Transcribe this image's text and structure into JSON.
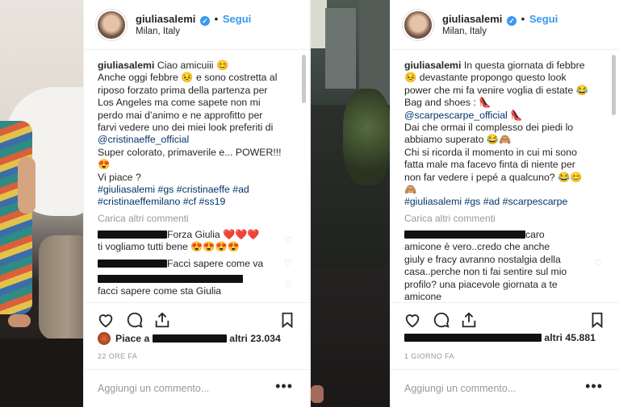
{
  "posts": [
    {
      "username": "giuliasalemi",
      "follow": "Segui",
      "location": "Milan, Italy",
      "caption": {
        "username": "giuliasalemi",
        "lines": [
          "Ciao amicuiii 😊",
          "Anche oggi febbre 😣 e sono costretta al",
          "riposo forzato prima della partenza per",
          "Los Angeles ma come sapete non mi",
          "perdo mai d’animo e ne approfitto per",
          "farvi vedere uno dei miei look preferiti di",
          "@cristinaeffe_official",
          "Super colorato, primaverile e... POWER!!!",
          "😍",
          "Vi piace ?",
          "#giuliasalemi #gs #cristinaeffe #ad",
          "#cristinaeffemilano #cf #ss19"
        ]
      },
      "load_more": "Carica altri commenti",
      "comments": [
        {
          "text": "Forza Giulia ❤️❤️❤️",
          "text2": "ti vogliamo tutti bene 😍😍😍😍"
        },
        {
          "text": "Facci sapere come va"
        },
        {
          "text": "facci sapere come sta Giulia"
        }
      ],
      "likes_prefix": "Piace a",
      "likes_suffix": "altri 23.034",
      "time": "22 ORE FA",
      "add_comment": "Aggiungi un commento...",
      "more_options": "•••"
    },
    {
      "username": "giuliasalemi",
      "follow": "Segui",
      "location": "Milan, Italy",
      "caption": {
        "username": "giuliasalemi",
        "lines": [
          "In questa giornata di febbre",
          "😣 devastante propongo questo look",
          "power che mi fa venire voglia di estate 😂",
          "Bag and shoes : 👠",
          "@scarpescarpe_official 👠",
          "Dai che ormai il complesso dei piedi lo",
          "abbiamo superato 😂🙈",
          "Chi si ricorda il momento in cui mi sono",
          "fatta male ma facevo finta di niente per",
          "non far vedere i pepé a qualcuno? 😂😊",
          "🙈",
          "#giuliasalemi #gs #ad #scarpescarpe"
        ]
      },
      "load_more": "Carica altri commenti",
      "comments": [
        {
          "lines": [
            "caro",
            "amicone è vero..credo che anche",
            "giuly e fracy avranno nostalgia della",
            "casa..perche non ti fai sentire sul mio",
            "profilo? una piacevole giornata a te",
            "amicone"
          ]
        }
      ],
      "likes_suffix": "altri 45.881",
      "time": "1 GIORNO FA",
      "add_comment": "Aggiungi un commento...",
      "more_options": "•••"
    }
  ]
}
